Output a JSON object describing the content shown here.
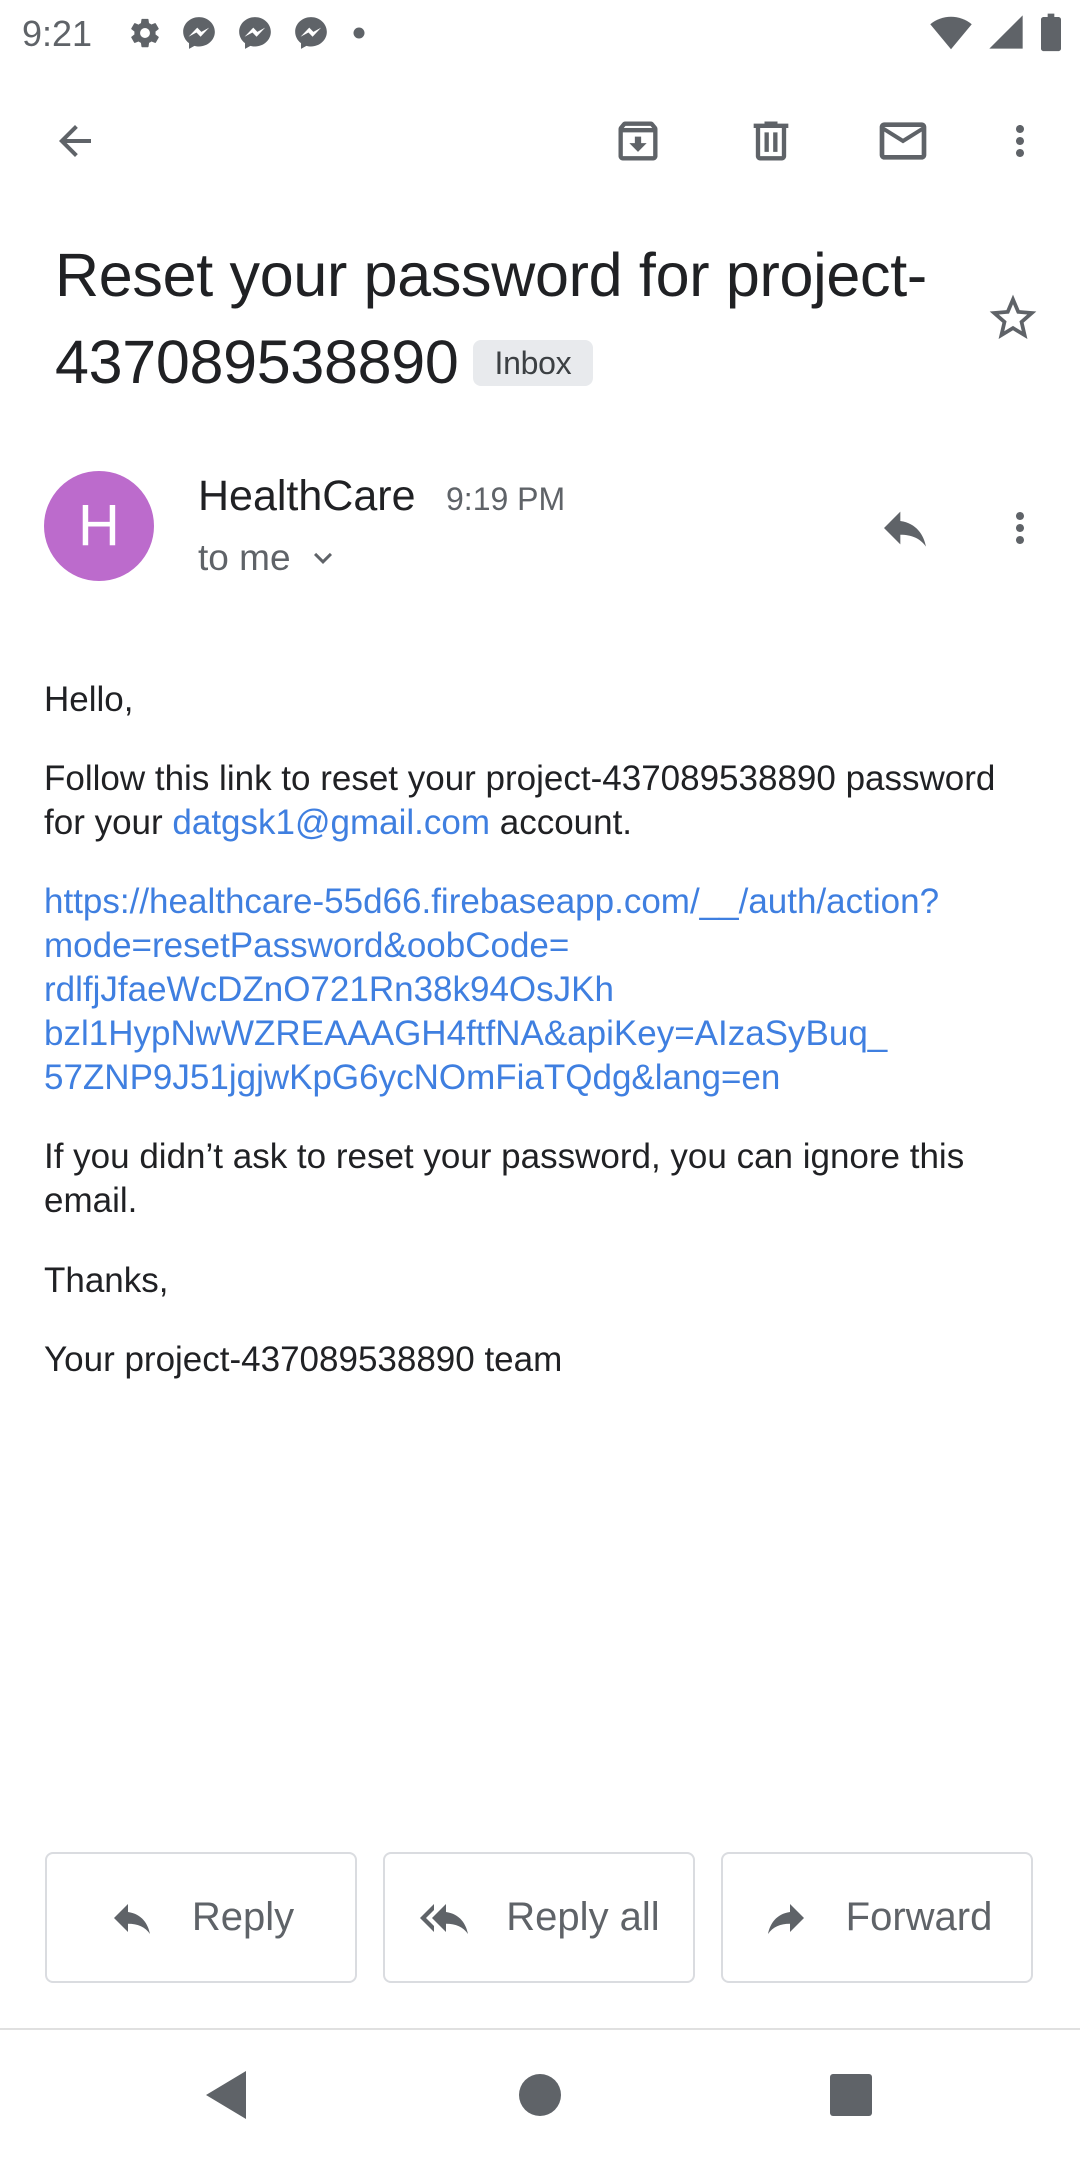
{
  "status_bar": {
    "time": "9:21",
    "left_icons": [
      "gear-icon",
      "messenger-icon",
      "messenger-icon",
      "messenger-icon",
      "dot-icon"
    ],
    "right_icons": [
      "wifi-icon",
      "signal-icon",
      "battery-icon"
    ]
  },
  "toolbar": {
    "back_icon": "arrow-back-icon",
    "actions": [
      "archive-icon",
      "delete-icon",
      "mark-unread-icon",
      "more-vert-icon"
    ]
  },
  "email": {
    "subject": "Reset your password for project-437089538890",
    "label": "Inbox",
    "starred": false,
    "sender": {
      "initial": "H",
      "name": "HealthCare",
      "time": "9:19 PM",
      "recipient": "to me",
      "avatar_color": "#bc6bcc"
    },
    "body": {
      "greeting": "Hello,",
      "p1_before": "Follow this link to reset your project-437089538890 password for your ",
      "p1_email": "datgsk1@gmail.com",
      "p1_after": " account.",
      "link_lines": [
        "https://healthcare-55d66.firebaseapp.com/__/auth/action?",
        "mode=resetPassword&oobCode=",
        "rdlfjJfaeWcDZnO721Rn38k94OsJKh",
        "bzl1HypNwWZREAAAGH4ftfNA&apiKey=AIzaSyBuq_",
        "57ZNP9J51jgjwKpG6ycNOmFiaTQdg&lang=en"
      ],
      "ignore_text": "If you didn’t ask to reset your password, you can ignore this email.",
      "thanks": "Thanks,",
      "signature": "Your project-437089538890 team"
    }
  },
  "actions": {
    "reply": "Reply",
    "reply_all": "Reply all",
    "forward": "Forward"
  },
  "nav_bar": {
    "buttons": [
      "nav-back-icon",
      "nav-home-icon",
      "nav-recents-icon"
    ]
  },
  "colors": {
    "link": "#3f7fe0",
    "icon": "#5f6368",
    "chip_bg": "#e8eaed"
  }
}
